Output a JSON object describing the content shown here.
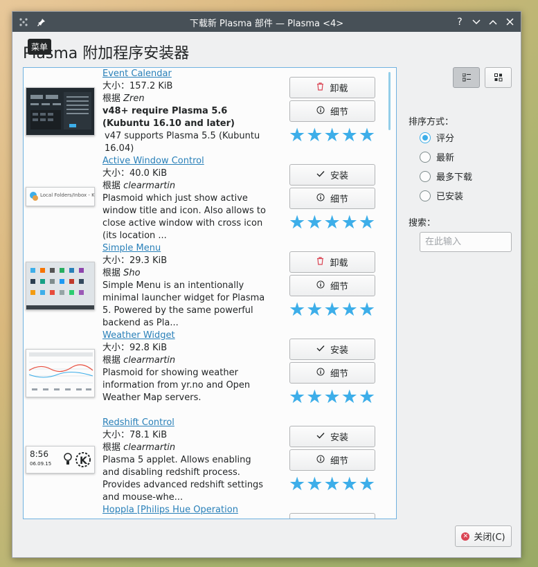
{
  "window": {
    "title": "下载新 Plasma 部件 — Plasma <4>",
    "tooltip": "菜单"
  },
  "page_title": "Plasma 附加程序安装器",
  "items": [
    {
      "name": "Event Calendar",
      "size": "大小：157.2 KiB",
      "by_prefix": "根据",
      "author": "Zren",
      "desc_bold": "v48+ require Plasma 5.6 (Kubuntu 16.10 and later)",
      "desc": "v47 supports Plasma 5.5 (Kubuntu 16.04)",
      "action_label": "卸载",
      "action_icon": "trash-icon",
      "details_label": "细节",
      "rating": 5
    },
    {
      "name": "Active Window Control",
      "size": "大小：40.0 KiB",
      "by_prefix": "根据",
      "author": "clearmartin",
      "desc": "Plasmoid which just show active window title and icon. Also allows to close active window with cross icon (its location ...",
      "action_label": "安装",
      "action_icon": "check-icon",
      "details_label": "细节",
      "rating": 5,
      "thumb_text": "Local Folders/Inbox - KMail"
    },
    {
      "name": "Simple Menu",
      "size": "大小：29.3 KiB",
      "by_prefix": "根据",
      "author": "Sho",
      "desc": "Simple Menu is an intentionally minimal launcher widget for Plasma 5. Powered by the same powerful backend as Pla...",
      "action_label": "卸载",
      "action_icon": "trash-icon",
      "details_label": "细节",
      "rating": 5
    },
    {
      "name": "Weather Widget",
      "size": "大小：92.8 KiB",
      "by_prefix": "根据",
      "author": "clearmartin",
      "desc": "Plasmoid for showing weather information from yr.no and Open Weather Map servers.",
      "action_label": "安装",
      "action_icon": "check-icon",
      "details_label": "细节",
      "rating": 5
    },
    {
      "name": "Redshift Control",
      "size": "大小：78.1 KiB",
      "by_prefix": "根据",
      "author": "clearmartin",
      "desc": "Plasma 5 applet. Allows enabling and disabling redshift process. Provides advanced redshift settings and mouse-whe...",
      "action_label": "安装",
      "action_icon": "check-icon",
      "details_label": "细节",
      "rating": 5,
      "thumb_time": "8:56",
      "thumb_date": "06.09.15"
    },
    {
      "name": "Hoppla [Philips Hue Operation"
    }
  ],
  "sort": {
    "label": "排序方式：",
    "options": [
      "评分",
      "最新",
      "最多下载",
      "已安装"
    ],
    "selected": "评分"
  },
  "search": {
    "label": "搜索：",
    "placeholder": "在此输入"
  },
  "close_label": "关闭(C)",
  "colors": {
    "accent": "#3daee9",
    "link": "#2980b9",
    "titlebar": "#475057",
    "danger": "#da4453"
  }
}
